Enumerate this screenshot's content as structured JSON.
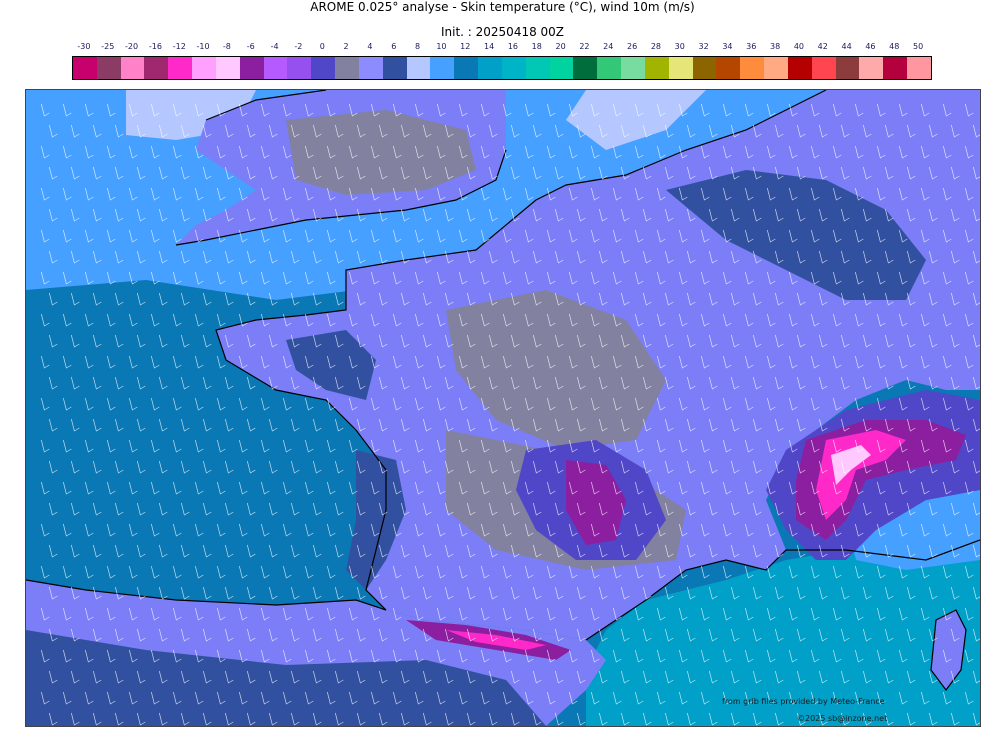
{
  "header": {
    "title": "AROME 0.025° analyse - Skin temperature (°C), wind 10m (m/s)",
    "init": "Init. : 20250418 00Z"
  },
  "colorbar": {
    "labels": [
      "-30",
      "-25",
      "-20",
      "-16",
      "-12",
      "-10",
      "-8",
      "-6",
      "-4",
      "-2",
      "0",
      "2",
      "4",
      "6",
      "8",
      "10",
      "12",
      "14",
      "16",
      "18",
      "20",
      "22",
      "24",
      "26",
      "28",
      "30",
      "32",
      "34",
      "36",
      "38",
      "40",
      "42",
      "44",
      "46",
      "48",
      "50"
    ],
    "colors": [
      "#c8006e",
      "#8c3c64",
      "#ff82c8",
      "#a0286e",
      "#ff28c8",
      "#ffa0ff",
      "#ffc8ff",
      "#8c1ea0",
      "#b45aff",
      "#9650f0",
      "#5046c8",
      "#8282a0",
      "#8c8cff",
      "#3250a0",
      "#b4c8ff",
      "#46a0ff",
      "#0a78b4",
      "#00a0c8",
      "#00b4c8",
      "#00c8b4",
      "#00d2a0",
      "#006e3c",
      "#32c878",
      "#78dca0",
      "#a0b400",
      "#e6e678",
      "#8c6400",
      "#b44600",
      "#ff8c3c",
      "#ffaa82",
      "#b40000",
      "#ff4650",
      "#8c3c3c",
      "#ffaaaa",
      "#b4003c",
      "#ff96a0"
    ]
  },
  "map": {
    "colors": {
      "sea_atlantic": "#0a78b4",
      "sea_channel": "#46a0ff",
      "sea_med": "#00a0c8",
      "land_main": "#7b7ef6",
      "land_cool": "#8282a0",
      "land_cold": "#5046c8",
      "land_mild": "#3250a0",
      "land_pale": "#b4c8ff",
      "mountain_cold": "#8c1ea0",
      "mountain_colder": "#ff28c8",
      "mountain_coldest": "#ffc8ff",
      "wind_barb": "#ffffff",
      "coastline": "#000000"
    }
  },
  "footer": {
    "source": "from grib files provided by Meteo-France",
    "copyright": "©2025 sb@inzone.net"
  }
}
